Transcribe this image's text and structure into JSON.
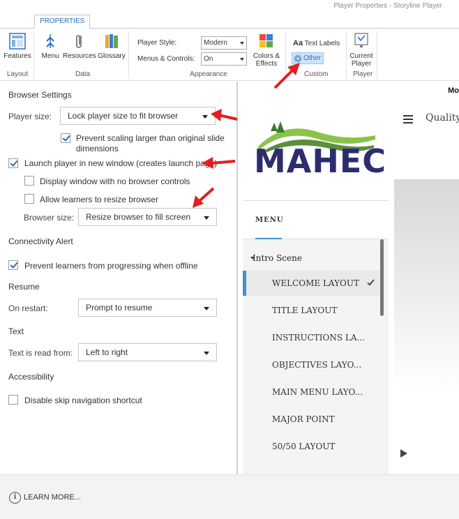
{
  "window": {
    "title": "Player Properties - Storyline Player"
  },
  "ribbon": {
    "tab": "PROPERTIES",
    "layout": {
      "features": "Features",
      "group": "Layout"
    },
    "data": {
      "menu": "Menu",
      "resources": "Resources",
      "glossary": "Glossary",
      "group": "Data"
    },
    "appearance": {
      "player_style_label": "Player Style:",
      "player_style_value": "Modern",
      "menus_controls_label": "Menus & Controls:",
      "menus_controls_value": "On",
      "colors_effects_line1": "Colors &",
      "colors_effects_line2": "Effects",
      "group": "Appearance"
    },
    "custom": {
      "text_labels": "Text Labels",
      "other": "Other",
      "group": "Custom"
    },
    "player": {
      "current_line1": "Current",
      "current_line2": "Player",
      "group": "Player"
    }
  },
  "settings": {
    "browser": {
      "heading": "Browser Settings",
      "player_size_label": "Player size:",
      "player_size_value": "Lock player size to fit browser",
      "prevent_scaling_line1": "Prevent scaling larger than original slide",
      "prevent_scaling_line2": "dimensions",
      "prevent_scaling_checked": true,
      "launch_new_window": "Launch player in new window (creates launch page)",
      "launch_new_window_checked": true,
      "no_browser_controls": "Display window with no browser controls",
      "no_browser_controls_checked": false,
      "allow_resize": "Allow learners to resize browser",
      "allow_resize_checked": false,
      "browser_size_label": "Browser size:",
      "browser_size_value": "Resize browser to fill screen"
    },
    "connectivity": {
      "heading": "Connectivity Alert",
      "prevent_offline": "Prevent learners from progressing when offline",
      "prevent_offline_checked": true
    },
    "resume": {
      "heading": "Resume",
      "on_restart_label": "On restart:",
      "on_restart_value": "Prompt to resume"
    },
    "text": {
      "heading": "Text",
      "read_from_label": "Text is read from:",
      "read_from_value": "Left to right"
    },
    "accessibility": {
      "heading": "Accessibility",
      "disable_skip_nav": "Disable skip navigation shortcut",
      "disable_skip_nav_checked": false
    }
  },
  "preview": {
    "top_text": "Mo",
    "logo_text": "MAHEC",
    "menu_header": "MENU",
    "quality_text": "Quality",
    "scene": "Intro Scene",
    "items": [
      "WELCOME LAYOUT",
      "TITLE LAYOUT",
      "INSTRUCTIONS LA...",
      "OBJECTIVES LAYO...",
      "MAIN MENU LAYO...",
      "MAJOR POINT",
      "50/50 LAYOUT"
    ],
    "active_index": 0
  },
  "footer": {
    "learn_more": "LEARN MORE..."
  },
  "colors": {
    "accent": "#2b6cc0",
    "logo_navy": "#2b2d6e",
    "logo_green": "#7cb342",
    "annotation_arrow": "#e02020"
  }
}
